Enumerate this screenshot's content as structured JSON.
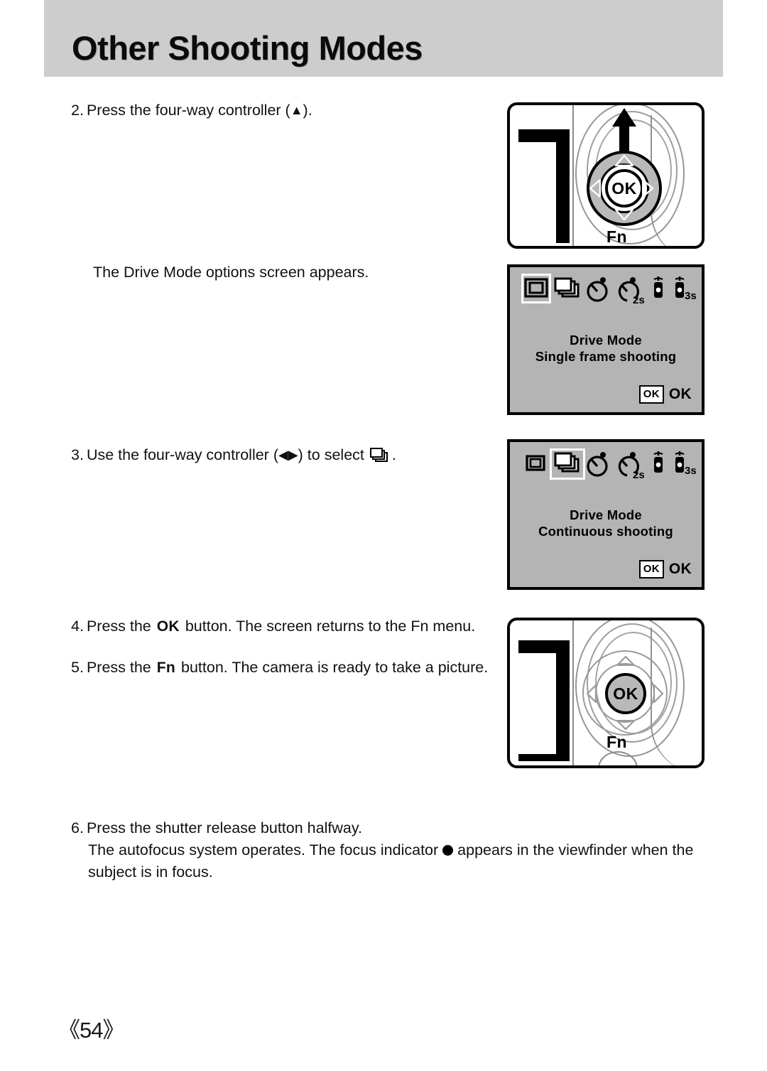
{
  "page": {
    "header_title": "Other Shooting Modes",
    "page_number": "《54》"
  },
  "steps": [
    {
      "id": "step-2",
      "number": "2.",
      "text": "Press the four-way controller (",
      "glyph": "▲",
      "text_end": ")."
    },
    {
      "id": "note-drive-mode",
      "text": "The Drive Mode options screen appears."
    },
    {
      "id": "step-3",
      "number": "3.",
      "text": "Use the four-way controller (",
      "glyph_left": "◀",
      "glyph_right": "▶",
      "text_mid": ") to select",
      "text_end": "."
    },
    {
      "id": "step-4",
      "number": "4.",
      "text_a": "Press the",
      "button": "OK",
      "text_b": "button. The screen returns to the Fn menu."
    },
    {
      "id": "step-5",
      "number": "5.",
      "text_a": "Press the",
      "button": "Fn",
      "text_b": "button. The camera is ready to take a picture."
    },
    {
      "id": "step-6",
      "number": "6.",
      "line1": "Press the shutter release button halfway.",
      "line2_a": "The autofocus system operates. The focus indicator",
      "line2_b": "appears in the viewfinder when the",
      "line3": "subject is in focus."
    }
  ],
  "figures": {
    "camera_up": {
      "ok_label": "OK",
      "fn_label": "Fn",
      "arrow_direction": "up"
    },
    "camera_ok": {
      "ok_label": "OK",
      "fn_label": "Fn"
    },
    "lcd_single": {
      "title_line1": "Drive Mode",
      "title_line2": "Single frame shooting",
      "ok_box": "OK",
      "ok_text": "OK",
      "selected_index": 0,
      "icons": [
        {
          "name": "single-frame-icon",
          "label": ""
        },
        {
          "name": "continuous-shooting-icon",
          "label": ""
        },
        {
          "name": "self-timer-icon",
          "label": ""
        },
        {
          "name": "self-timer-2s-icon",
          "label": "2s"
        },
        {
          "name": "remote-control-icon",
          "label": ""
        },
        {
          "name": "remote-control-3s-icon",
          "label": "3s"
        },
        {
          "name": "auto-bracket-icon",
          "label": ""
        }
      ]
    },
    "lcd_continuous": {
      "title_line1": "Drive Mode",
      "title_line2": "Continuous shooting",
      "ok_box": "OK",
      "ok_text": "OK",
      "selected_index": 1,
      "icons": [
        {
          "name": "single-frame-icon",
          "label": ""
        },
        {
          "name": "continuous-shooting-icon",
          "label": ""
        },
        {
          "name": "self-timer-icon",
          "label": ""
        },
        {
          "name": "self-timer-2s-icon",
          "label": "2s"
        },
        {
          "name": "remote-control-icon",
          "label": ""
        },
        {
          "name": "remote-control-3s-icon",
          "label": "3s"
        },
        {
          "name": "auto-bracket-icon",
          "label": ""
        }
      ]
    }
  },
  "colors": {
    "header_band": "#cdcdcd",
    "lcd_background": "#b4b4b4",
    "dial_gray": "#b9b9b9",
    "ink": "#000000"
  }
}
